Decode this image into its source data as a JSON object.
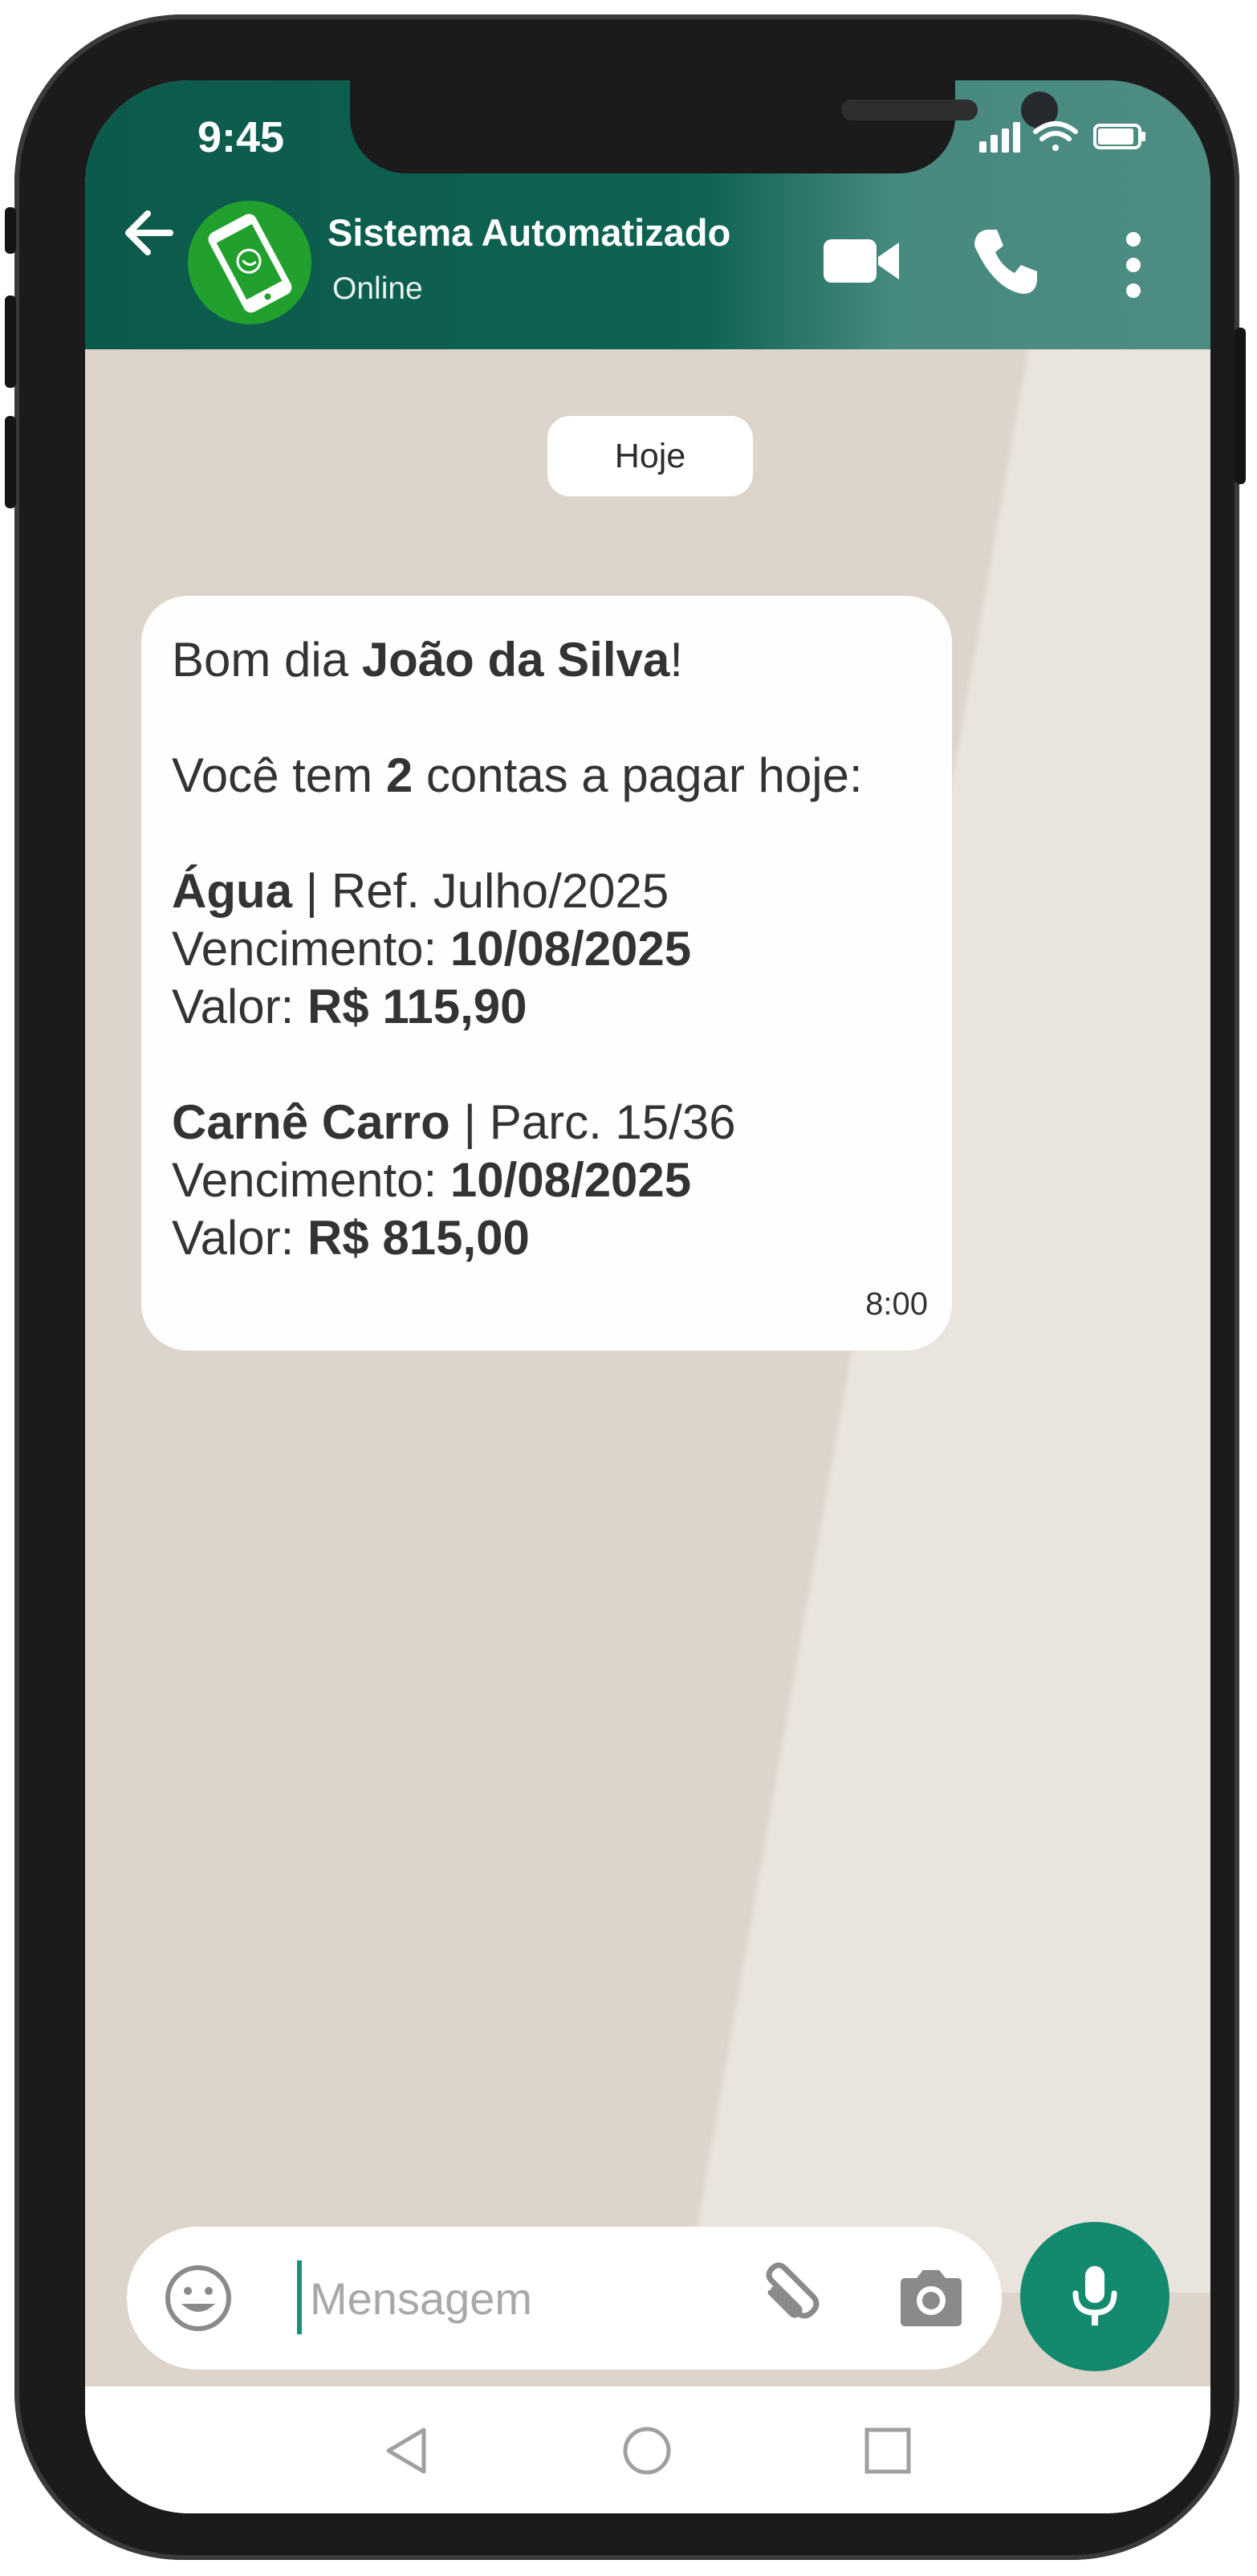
{
  "status_bar": {
    "time": "9:45"
  },
  "header": {
    "contact_name": "Sistema Automatizado",
    "contact_status": "Online"
  },
  "chat": {
    "date_chip": "Hoje",
    "message": {
      "greeting_prefix": "Bom dia ",
      "greeting_name": "João da Silva",
      "greeting_suffix": "!",
      "count_prefix": "Você tem ",
      "count_value": "2",
      "count_suffix": " contas a pagar hoje:",
      "bills": [
        {
          "name": "Água",
          "ref": " | Ref. Julho/2025",
          "due_label": "Vencimento: ",
          "due_date": "10/08/2025",
          "amount_label": "Valor: ",
          "amount": "R$ 115,90"
        },
        {
          "name": "Carnê Carro",
          "ref": " | Parc. 15/36",
          "due_label": "Vencimento: ",
          "due_date": "10/08/2025",
          "amount_label": "Valor: ",
          "amount": "R$ 815,00"
        }
      ],
      "time": "8:00"
    }
  },
  "composer": {
    "placeholder": "Mensagem"
  },
  "colors": {
    "header": "#0f6353",
    "accent": "#138a6d",
    "chat_bg": "#ddd5cb",
    "bubble": "#fefefe",
    "avatar": "#22a02e"
  },
  "icons": [
    "back-arrow-icon",
    "whatsapp-phone-icon",
    "video-icon",
    "phone-icon",
    "more-icon",
    "emoji-icon",
    "attach-icon",
    "camera-icon",
    "mic-icon",
    "nav-back-icon",
    "nav-home-icon",
    "nav-recents-icon"
  ]
}
